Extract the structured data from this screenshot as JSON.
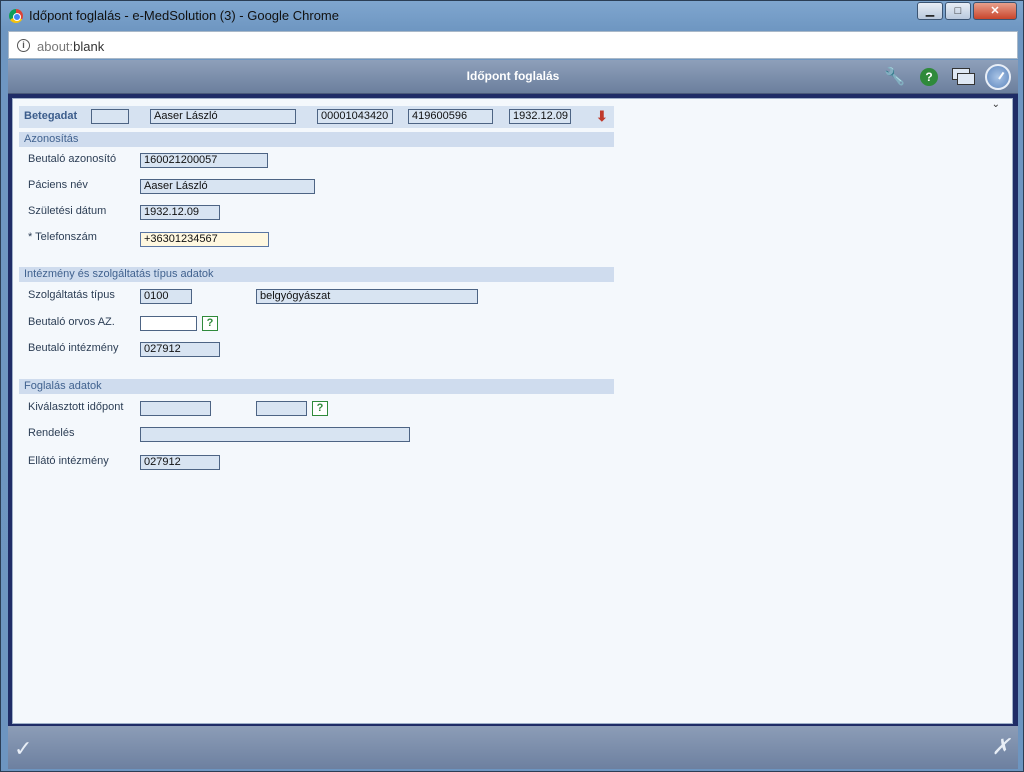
{
  "window": {
    "title": "Időpont foglalás - e-MedSolution (3) - Google Chrome",
    "minimize": "▁",
    "maximize": "□",
    "close": "✕"
  },
  "address": {
    "scheme": "about:",
    "rest": "blank"
  },
  "app": {
    "title": "Időpont foglalás"
  },
  "patient_bar": {
    "label": "Betegadat",
    "field1": "",
    "name": "Aaser László",
    "id1": "00001043420",
    "id2": "419600596",
    "dob": "1932.12.09"
  },
  "sections": {
    "identification": "Azonosítás",
    "institution": "Intézmény és szolgáltatás típus adatok",
    "booking": "Foglalás adatok"
  },
  "identification": {
    "referral_id_label": "Beutaló azonosító",
    "referral_id": "160021200057",
    "patient_name_label": "Páciens név",
    "patient_name": "Aaser László",
    "dob_label": "Születési dátum",
    "dob": "1932.12.09",
    "phone_label": "* Telefonszám",
    "phone": "+36301234567"
  },
  "institution": {
    "service_type_label": "Szolgáltatás típus",
    "service_code": "0100",
    "service_name": "belgyógyászat",
    "doctor_label": "Beutaló orvos AZ.",
    "doctor": "",
    "referring_inst_label": "Beutaló intézmény",
    "referring_inst": "027912"
  },
  "booking": {
    "selected_time_label": "Kiválasztott időpont",
    "selected_time_1": "",
    "selected_time_2": "",
    "ordering_label": "Rendelés",
    "ordering": "",
    "provider_label": "Ellátó intézmény",
    "provider": "027912"
  },
  "help_glyph": "?"
}
